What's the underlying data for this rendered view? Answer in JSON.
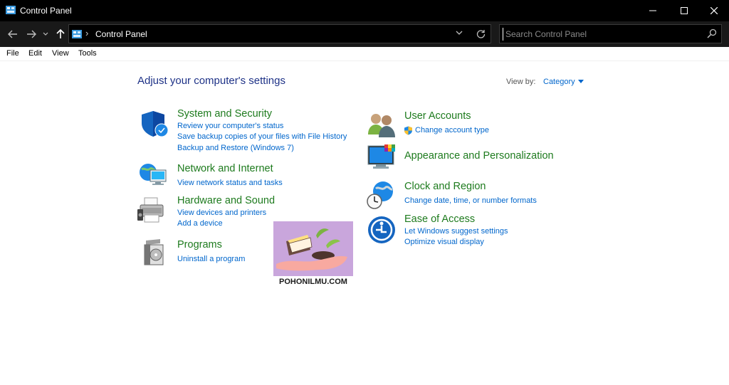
{
  "window": {
    "title": "Control Panel"
  },
  "address": {
    "breadcrumb": "Control Panel",
    "separator": "›"
  },
  "search": {
    "placeholder": "Search Control Panel"
  },
  "menu": [
    "File",
    "Edit",
    "View",
    "Tools"
  ],
  "main": {
    "heading": "Adjust your computer's settings",
    "view_by_label": "View by:",
    "view_by_value": "Category"
  },
  "categories": {
    "system": {
      "title": "System and Security",
      "links": [
        "Review your computer's status",
        "Save backup copies of your files with File History",
        "Backup and Restore (Windows 7)"
      ]
    },
    "network": {
      "title": "Network and Internet",
      "links": [
        "View network status and tasks"
      ]
    },
    "hardware": {
      "title": "Hardware and Sound",
      "links": [
        "View devices and printers",
        "Add a device"
      ]
    },
    "programs": {
      "title": "Programs",
      "links": [
        "Uninstall a program"
      ]
    },
    "users": {
      "title": "User Accounts",
      "links": [
        "Change account type"
      ]
    },
    "appearance": {
      "title": "Appearance and Personalization",
      "links": []
    },
    "clock": {
      "title": "Clock and Region",
      "links": [
        "Change date, time, or number formats"
      ]
    },
    "ease": {
      "title": "Ease of Access",
      "links": [
        "Let Windows suggest settings",
        "Optimize visual display"
      ]
    }
  },
  "watermark": {
    "text": "POHONILMU.COM"
  },
  "colors": {
    "category_title": "#1e7b1e",
    "link": "#0066cc",
    "heading": "#1e3287",
    "titlebar": "#000000",
    "navbar": "#191919"
  }
}
